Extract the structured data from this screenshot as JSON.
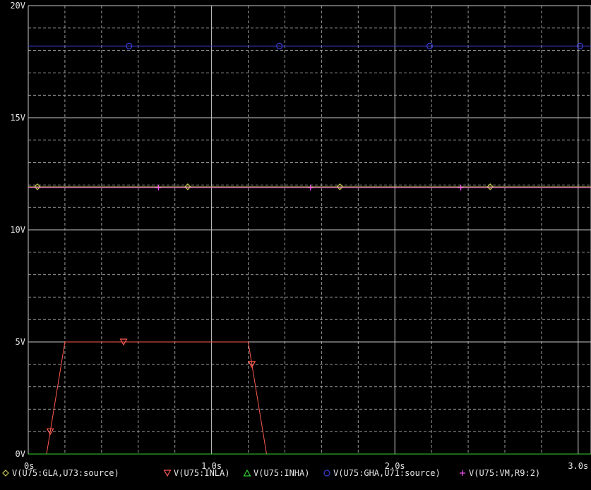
{
  "chart_data": {
    "type": "line",
    "title": "",
    "xlabel": "",
    "ylabel": "",
    "xlim": [
      0,
      3.07
    ],
    "ylim": [
      0,
      20
    ],
    "x_ticks": [
      {
        "value": 0,
        "label": "0s"
      },
      {
        "value": 1.0,
        "label": "1.0s"
      },
      {
        "value": 2.0,
        "label": "2.0s"
      },
      {
        "value": 3.0,
        "label": "3.0s"
      }
    ],
    "y_ticks": [
      {
        "value": 0,
        "label": "0V"
      },
      {
        "value": 5,
        "label": "5V"
      },
      {
        "value": 10,
        "label": "10V"
      },
      {
        "value": 15,
        "label": "15V"
      },
      {
        "value": 20,
        "label": "20V"
      }
    ],
    "grid": true,
    "grid_minor_x": [
      0.2,
      0.4,
      0.6,
      0.8,
      1.2,
      1.4,
      1.6,
      1.8,
      2.2,
      2.4,
      2.6,
      2.8
    ],
    "grid_minor_y": [
      1,
      2,
      3,
      4,
      6,
      7,
      8,
      9,
      11,
      12,
      13,
      14,
      16,
      17,
      18,
      19
    ],
    "legend_position": "bottom",
    "series": [
      {
        "name": "V(U75:GLA,U73:source)",
        "color": "#c8c850",
        "marker": "diamond",
        "x": [
          0,
          3.07
        ],
        "y": [
          11.92,
          11.92
        ],
        "marker_x": [
          0.05,
          0.87,
          1.7,
          2.52
        ]
      },
      {
        "name": "V(U75:INLA)",
        "color": "#ff5a50",
        "marker": "triangle-down",
        "x": [
          0.1,
          0.2,
          1.2,
          1.3
        ],
        "y": [
          0,
          5,
          5,
          0
        ],
        "marker_x": [
          0.12,
          0.52,
          1.22
        ]
      },
      {
        "name": "V(U75:INHA)",
        "color": "#30d030",
        "marker": "triangle-up",
        "x": [
          0,
          3.07
        ],
        "y": [
          0,
          0
        ],
        "marker_x": []
      },
      {
        "name": "V(U75:GHA,U71:source)",
        "color": "#3c3cd2",
        "marker": "circle",
        "x": [
          0,
          3.07
        ],
        "y": [
          18.2,
          18.2
        ],
        "marker_x": [
          0.55,
          1.37,
          2.19,
          3.01
        ]
      },
      {
        "name": "V(U75:VM,R9:2)",
        "color": "#ff50ff",
        "marker": "plus",
        "x": [
          0,
          3.07
        ],
        "y": [
          11.88,
          11.88
        ],
        "marker_x": [
          0.71,
          1.54,
          2.36
        ]
      }
    ]
  }
}
